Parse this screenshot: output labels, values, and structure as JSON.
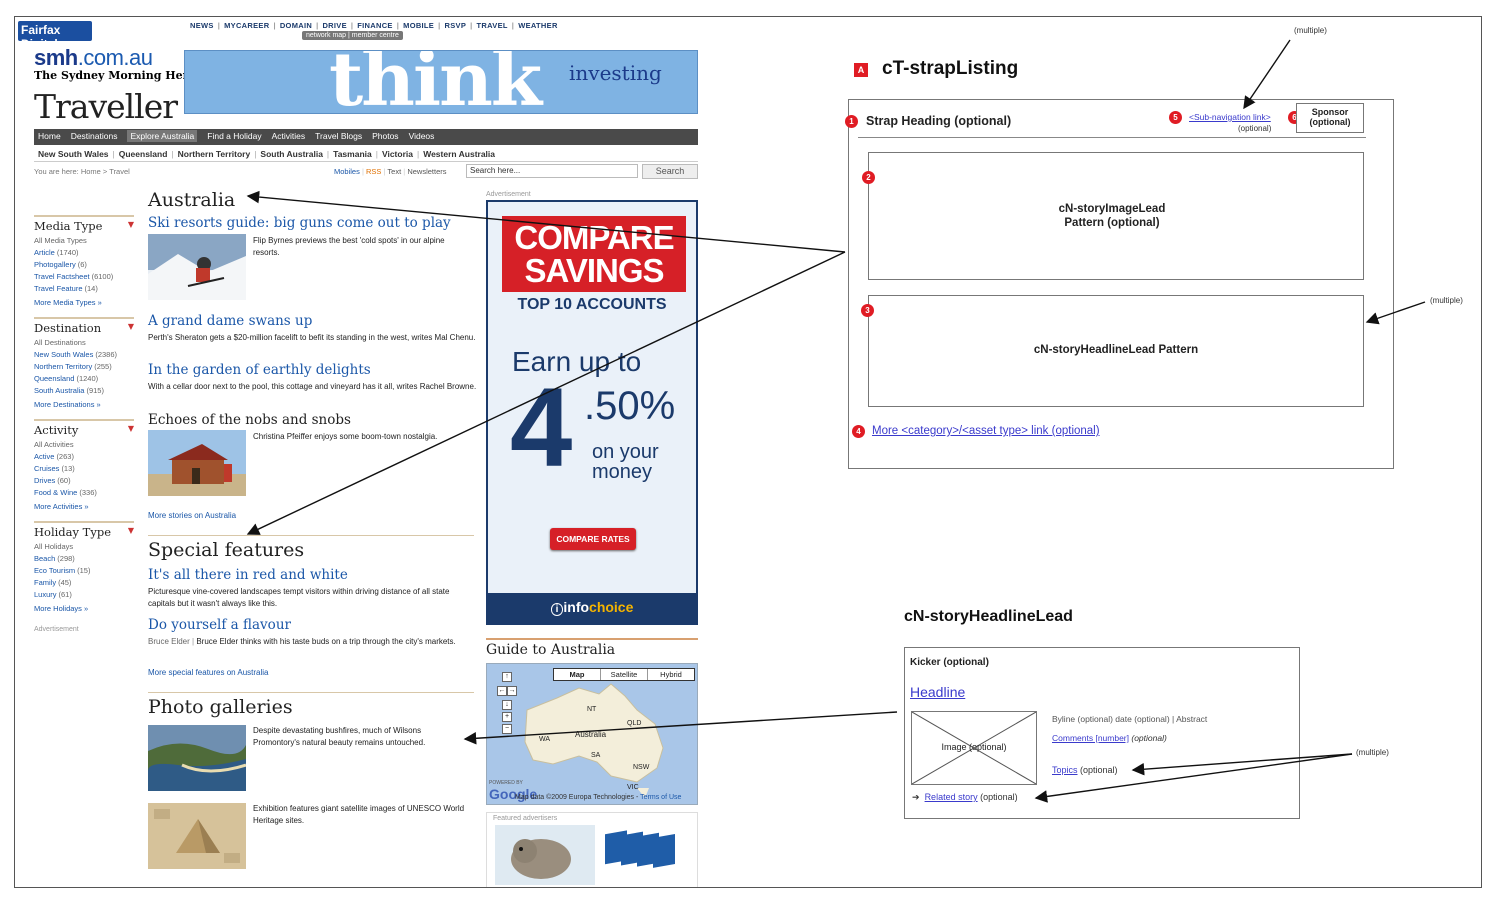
{
  "site": {
    "fairfax_logo": "Fairfax Digital",
    "top_nav": [
      "NEWS",
      "MYCAREER",
      "DOMAIN",
      "DRIVE",
      "FINANCE",
      "MOBILE",
      "RSVP",
      "TRAVEL",
      "WEATHER"
    ],
    "sub_top": "network map | member centre",
    "smh_logo_main": "smh",
    "smh_logo_suffix": ".com.au",
    "smh_fullname": "The Sydney Morning Herald",
    "section_logo": "Traveller",
    "banner_think": "think",
    "banner_investing": "investing",
    "main_nav": [
      "Home",
      "Destinations",
      "Explore Australia",
      "Find a Holiday",
      "Activities",
      "Travel Blogs",
      "Photos",
      "Videos"
    ],
    "sub_nav": [
      "New South Wales",
      "Queensland",
      "Northern Territory",
      "South Australia",
      "Tasmania",
      "Victoria",
      "Western Australia"
    ],
    "breadcrumb": "You are here: Home > Travel",
    "util_links": [
      "Mobiles",
      "RSS",
      "Text",
      "Newsletters"
    ],
    "search_placeholder": "Search here...",
    "search_button": "Search",
    "filters": [
      {
        "title": "Media Type",
        "items": [
          [
            "All Media Types",
            ""
          ],
          [
            "Article",
            "(1740)"
          ],
          [
            "Photogallery",
            "(6)"
          ],
          [
            "Travel Factsheet",
            "(6100)"
          ],
          [
            "Travel Feature",
            "(14)"
          ]
        ],
        "more": "More Media Types »"
      },
      {
        "title": "Destination",
        "items": [
          [
            "All Destinations",
            ""
          ],
          [
            "New South Wales",
            "(2386)"
          ],
          [
            "Northern Territory",
            "(255)"
          ],
          [
            "Queensland",
            "(1240)"
          ],
          [
            "South Australia",
            "(915)"
          ]
        ],
        "more": "More Destinations »"
      },
      {
        "title": "Activity",
        "items": [
          [
            "All Activities",
            ""
          ],
          [
            "Active",
            "(263)"
          ],
          [
            "Cruises",
            "(13)"
          ],
          [
            "Drives",
            "(60)"
          ],
          [
            "Food & Wine",
            "(336)"
          ]
        ],
        "more": "More Activities »"
      },
      {
        "title": "Holiday Type",
        "items": [
          [
            "All Holidays",
            ""
          ],
          [
            "Beach",
            "(298)"
          ],
          [
            "Eco Tourism",
            "(15)"
          ],
          [
            "Family",
            "(45)"
          ],
          [
            "Luxury",
            "(61)"
          ]
        ],
        "more": "More Holidays »"
      }
    ],
    "left_ad_label": "Advertisement",
    "australia": {
      "heading": "Australia",
      "story1_headline": "Ski resorts guide: big guns come out to play",
      "story1_abstract": "Flip Byrnes previews the best 'cold spots' in our alpine resorts.",
      "story2_headline": "A grand dame swans up",
      "story2_abstract": "Perth's Sheraton gets a $20-million facelift to befit its standing in the west, writes Mal Chenu.",
      "story3_headline": "In the garden of earthly delights",
      "story3_abstract": "With a cellar door next to the pool, this cottage and vineyard has it all, writes Rachel Browne.",
      "story4_headline": "Echoes of the nobs and snobs",
      "story4_abstract": "Christina Pfeiffer enjoys some boom-town nostalgia.",
      "more": "More stories on Australia"
    },
    "special": {
      "heading": "Special features",
      "story1_headline": "It's all there in red and white",
      "story1_abstract": "Picturesque vine-covered landscapes tempt visitors within driving distance of all state capitals but it wasn't always like this.",
      "story2_headline": "Do yourself a flavour",
      "story2_byline": "Bruce Elder",
      "story2_abstract": "Bruce Elder thinks with his taste buds on a trip through the city's markets.",
      "more": "More special features on Australia"
    },
    "photos": {
      "heading": "Photo galleries",
      "story1_abstract": "Despite devastating bushfires, much of Wilsons Promontory's natural beauty remains untouched.",
      "story2_abstract": "Exhibition features giant satellite images of UNESCO World Heritage sites."
    },
    "ad": {
      "label": "Advertisement",
      "compare": "COMPARE",
      "savings": "SAVINGS",
      "top10": "TOP 10 ACCOUNTS",
      "earn": "Earn up to",
      "four": "4",
      "fifty": ".50%",
      "on_your": "on your",
      "money": "money",
      "button": "COMPARE RATES",
      "brand_i": "i",
      "brand_info": "info",
      "brand_choice": "choice"
    },
    "guide": {
      "heading": "Guide to Australia",
      "tabs": [
        "Map",
        "Satellite",
        "Hybrid"
      ],
      "labels": [
        "NT",
        "QLD",
        "WA",
        "Australia",
        "SA",
        "NSW",
        "VIC"
      ],
      "google": "Google",
      "map_data": "Map data ©2009 Europa Technologies -",
      "terms": "Terms of Use",
      "powered": "POWERED BY"
    },
    "featured_label": "Featured advertisers"
  },
  "diagram": {
    "badge": "A",
    "title": "cT-strapListing",
    "multiple_top": "(multiple)",
    "strap_heading": "Strap Heading (optional)",
    "subnav_link": "<Sub-navigation link>",
    "subnav_optional": "(optional)",
    "sponsor": "Sponsor",
    "sponsor_optional": "(optional)",
    "image_lead_line1": "cN-storyImageLead",
    "image_lead_line2": "Pattern (optional)",
    "headline_lead": "cN-storyHeadlineLead Pattern",
    "multiple_right": "(multiple)",
    "more_link": "More <category>/<asset type> link (optional)",
    "nums": [
      "1",
      "2",
      "3",
      "4",
      "5",
      "6"
    ],
    "title2": "cN-storyHeadlineLead",
    "kicker": "Kicker (optional)",
    "headline": "Headline",
    "image": "Image (optional)",
    "byline": "Byline (optional) date (optional) | Abstract",
    "comments": "Comments [number]",
    "comments_opt": "(optional)",
    "topics": "Topics",
    "topics_opt": "(optional)",
    "related": "Related story",
    "related_opt": "(optional)",
    "multiple_bottom": "(multiple)"
  }
}
